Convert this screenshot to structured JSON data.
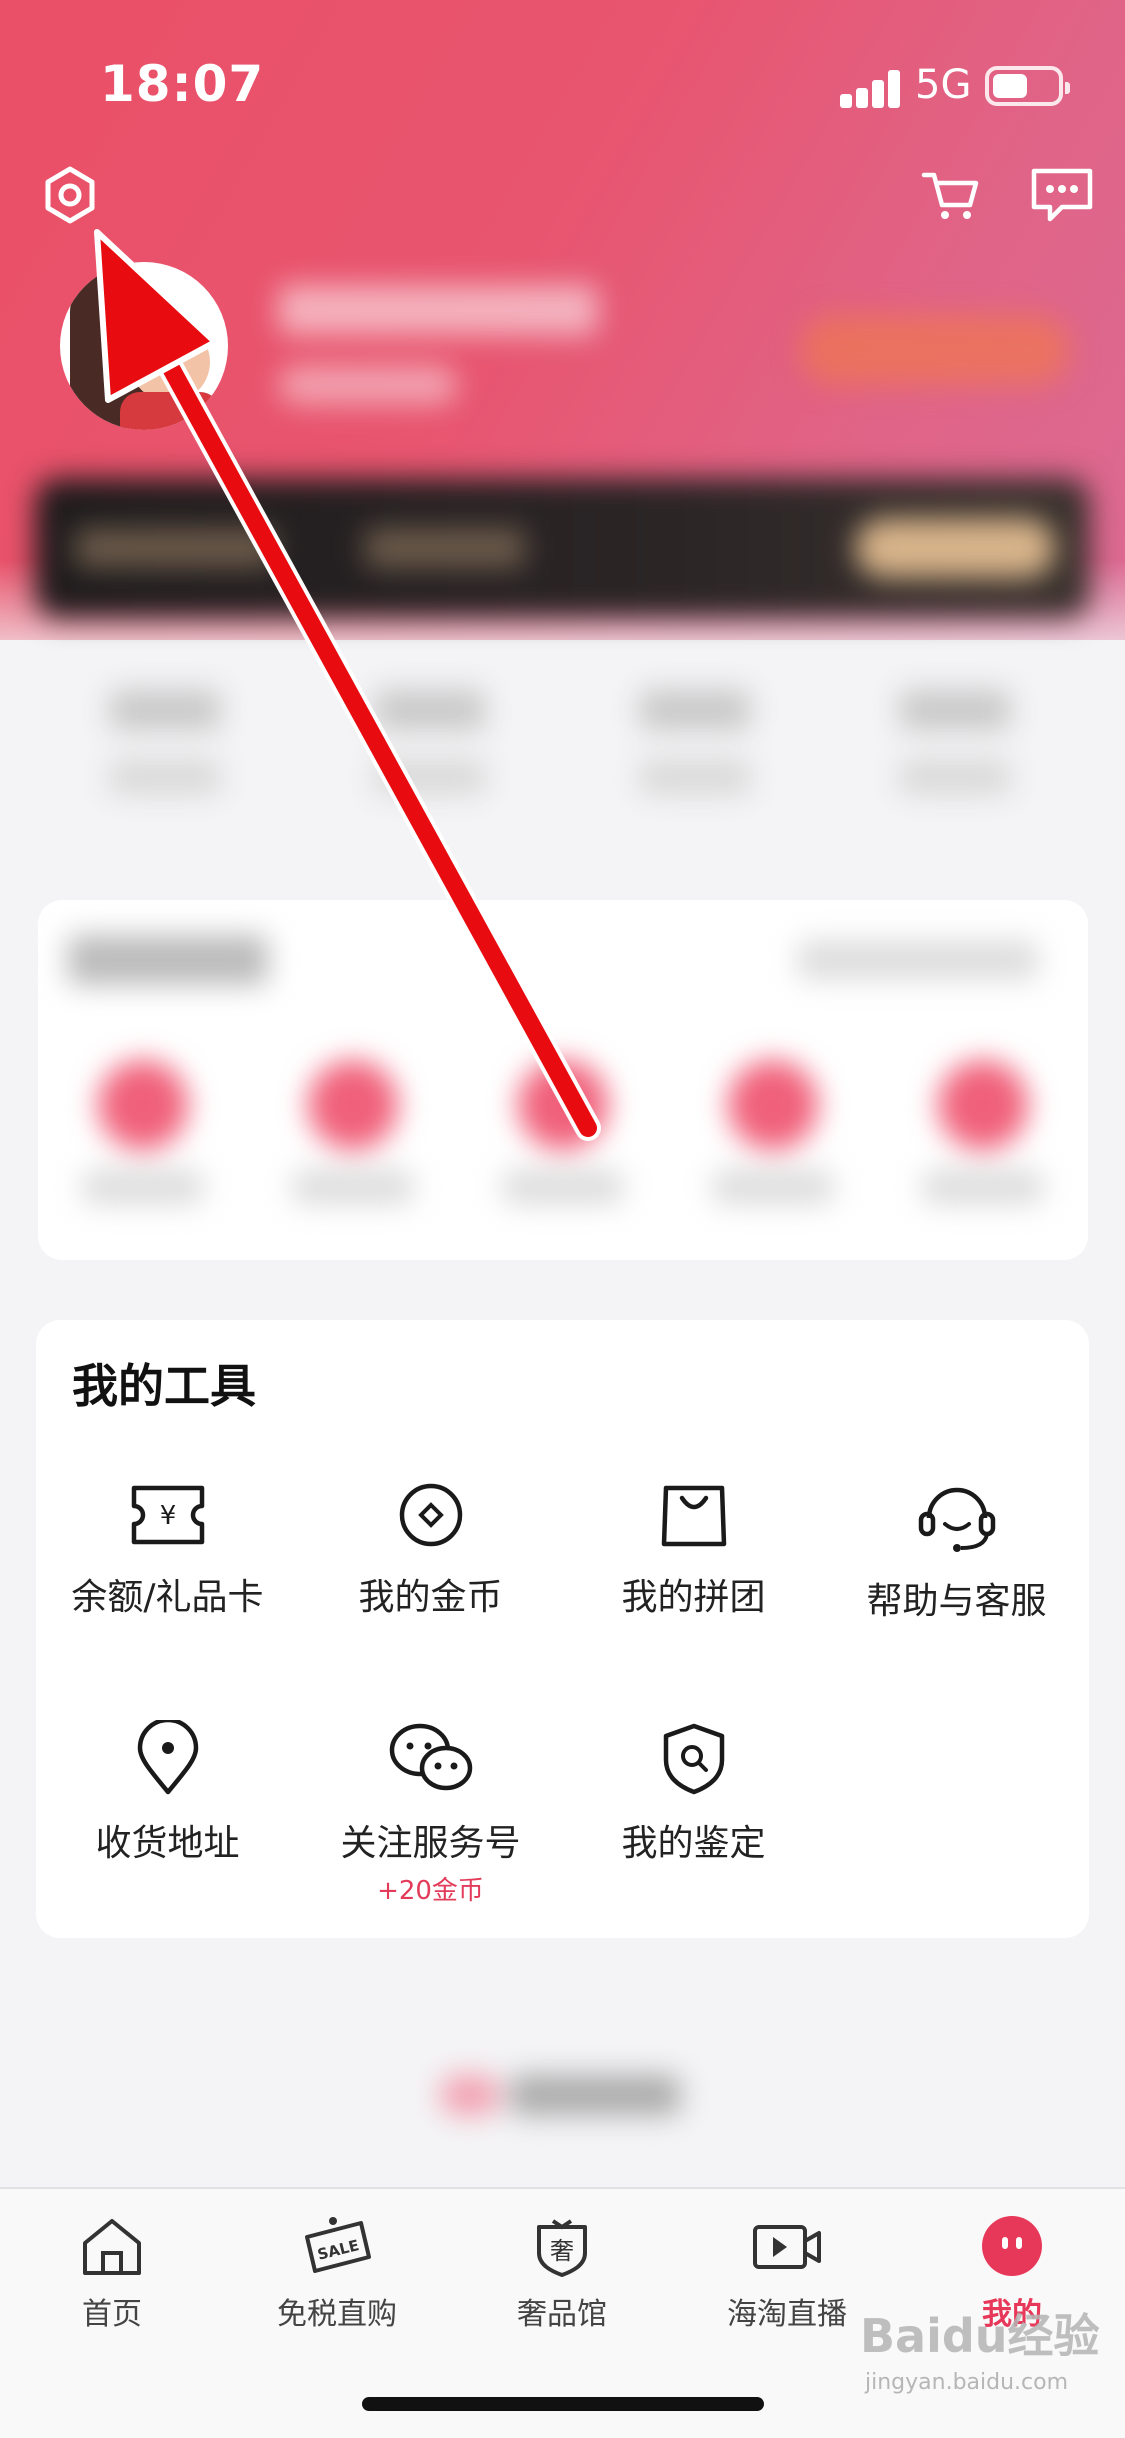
{
  "status_bar": {
    "time": "18:07",
    "network": "5G"
  },
  "header": {
    "icons": [
      "settings-icon",
      "cart-icon",
      "message-icon"
    ]
  },
  "tools": {
    "title": "我的工具",
    "items": [
      {
        "label": "余额/礼品卡",
        "icon": "voucher-icon"
      },
      {
        "label": "我的金币",
        "icon": "coin-icon"
      },
      {
        "label": "我的拼团",
        "icon": "shopping-bag-icon"
      },
      {
        "label": "帮助与客服",
        "icon": "headset-icon"
      },
      {
        "label": "收货地址",
        "icon": "location-pin-icon"
      },
      {
        "label": "关注服务号",
        "icon": "wechat-icon",
        "sub": "+20金币"
      },
      {
        "label": "我的鉴定",
        "icon": "shield-search-icon"
      }
    ]
  },
  "tabbar": {
    "tabs": [
      {
        "label": "首页",
        "icon": "home-icon"
      },
      {
        "label": "免税直购",
        "icon": "sale-tag-icon",
        "badge": "SALE"
      },
      {
        "label": "奢品馆",
        "icon": "luxury-icon",
        "badge": "奢"
      },
      {
        "label": "海淘直播",
        "icon": "live-video-icon"
      },
      {
        "label": "我的",
        "icon": "profile-face-icon"
      }
    ]
  },
  "watermark": {
    "brand": "Baidu经验",
    "url": "jingyan.baidu.com"
  },
  "colors": {
    "accent": "#e8385a",
    "header": "#e8556f"
  }
}
